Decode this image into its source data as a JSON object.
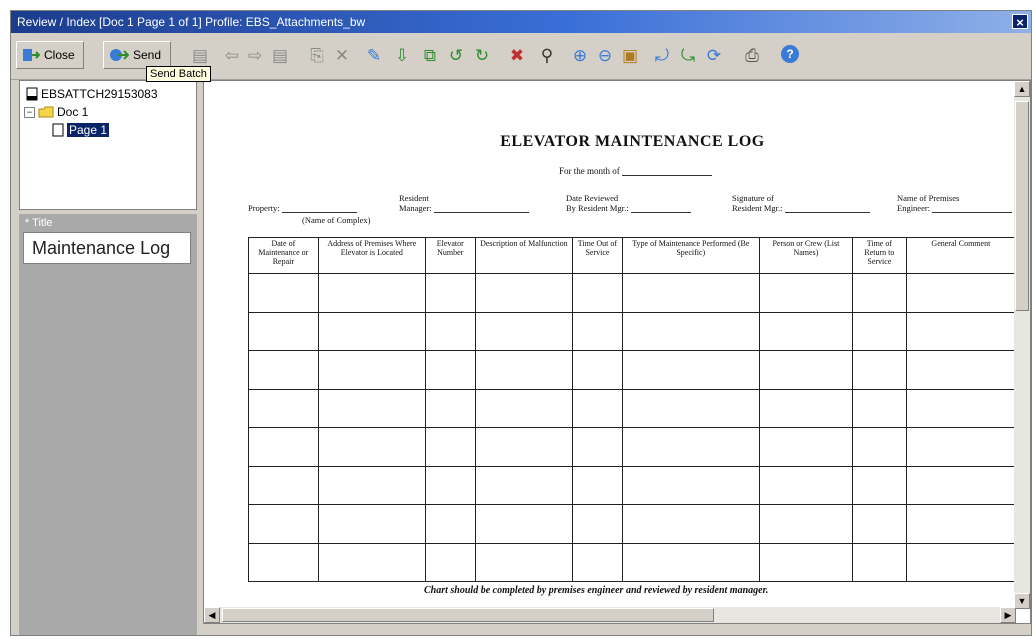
{
  "window": {
    "title": "Review / Index [Doc 1 Page 1 of 1] Profile: EBS_Attachments_bw",
    "close_glyph": "×"
  },
  "toolbar": {
    "close_label": "Close",
    "send_label": "Send",
    "tooltip": "Send Batch",
    "icons": [
      "page-icon",
      "back-arrow-icon",
      "forward-arrow-icon",
      "page-icon",
      "insert-page-icon",
      "delete-page-icon",
      "annotate-icon",
      "move-down-icon",
      "split-icon",
      "rotate-left-icon",
      "rotate-right-icon",
      "remove-page-icon",
      "find-icon",
      "zoom-in-icon",
      "zoom-out-icon",
      "fit-icon",
      "rotate-icon",
      "rotate-page-icon",
      "refresh-icon",
      "print-icon",
      "help-icon"
    ]
  },
  "tree": {
    "root": "EBSATTCH29153083",
    "doc": "Doc 1",
    "page": "Page 1"
  },
  "index": {
    "field_label": "* Title",
    "field_value": "Maintenance Log"
  },
  "document": {
    "title": "ELEVATOR MAINTENANCE LOG",
    "month_label": "For the month of",
    "property_label": "Property:",
    "property_sub": "(Name of Complex)",
    "manager_label_1": "Resident",
    "manager_label_2": "Manager:",
    "reviewed_label_1": "Date Reviewed",
    "reviewed_label_2": "By Resident Mgr.:",
    "signature_label_1": "Signature of",
    "signature_label_2": "Resident Mgr.:",
    "premises_label_1": "Name of Premises",
    "premises_label_2": "Engineer:",
    "columns": [
      "Date of Maintenance or Repair",
      "Address of Premises Where Elevator is Located",
      "Elevator Number",
      "Description of Malfunction",
      "Time Out of Service",
      "Type of Maintenance Performed (Be Specific)",
      "Person or Crew (List Names)",
      "Time of Return to Service",
      "General Comment"
    ],
    "footnote": "Chart should be completed by premises engineer and reviewed by resident manager."
  }
}
